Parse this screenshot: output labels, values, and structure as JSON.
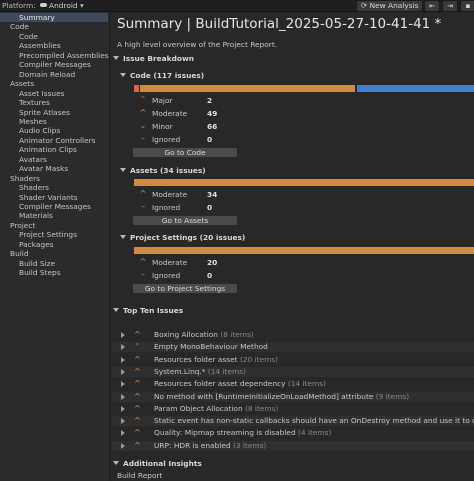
{
  "toolbar": {
    "platform_label": "Platform:",
    "platform_value": "Android",
    "new_analysis_label": "New Analysis",
    "import_icon": "import-icon",
    "export_icon": "export-icon"
  },
  "sidebar": {
    "items": [
      {
        "label": "Summary",
        "indent": 1,
        "selected": true
      },
      {
        "label": "Code",
        "indent": 0
      },
      {
        "label": "Code",
        "indent": 1
      },
      {
        "label": "Assemblies",
        "indent": 1
      },
      {
        "label": "Precompiled Assemblies",
        "indent": 1
      },
      {
        "label": "Compiler Messages",
        "indent": 1
      },
      {
        "label": "Domain Reload",
        "indent": 1
      },
      {
        "label": "Assets",
        "indent": 0
      },
      {
        "label": "Asset Issues",
        "indent": 1
      },
      {
        "label": "Textures",
        "indent": 1
      },
      {
        "label": "Sprite Atlases",
        "indent": 1
      },
      {
        "label": "Meshes",
        "indent": 1
      },
      {
        "label": "Audio Clips",
        "indent": 1
      },
      {
        "label": "Animator Controllers",
        "indent": 1
      },
      {
        "label": "Animation Clips",
        "indent": 1
      },
      {
        "label": "Avatars",
        "indent": 1
      },
      {
        "label": "Avatar Masks",
        "indent": 1
      },
      {
        "label": "Shaders",
        "indent": 0
      },
      {
        "label": "Shaders",
        "indent": 1
      },
      {
        "label": "Shader Variants",
        "indent": 1
      },
      {
        "label": "Compiler Messages",
        "indent": 1
      },
      {
        "label": "Materials",
        "indent": 1
      },
      {
        "label": "Project",
        "indent": 0
      },
      {
        "label": "Project Settings",
        "indent": 1
      },
      {
        "label": "Packages",
        "indent": 1
      },
      {
        "label": "Build",
        "indent": 0
      },
      {
        "label": "Build Size",
        "indent": 1
      },
      {
        "label": "Build Steps",
        "indent": 1
      }
    ]
  },
  "main": {
    "title": "Summary  |  BuildTutorial_2025-05-27-10-41-41 *",
    "subtitle": "A high level overview of the Project Report.",
    "issue_breakdown_label": "Issue Breakdown",
    "code": {
      "header": "Code (117 issues)",
      "rows": [
        {
          "label": "Major",
          "value": "2",
          "icon": "major-severity-icon"
        },
        {
          "label": "Moderate",
          "value": "49",
          "icon": "moderate-severity-icon"
        },
        {
          "label": "Minor",
          "value": "66",
          "icon": "minor-severity-icon"
        },
        {
          "label": "Ignored",
          "value": "0",
          "icon": "ignored-icon"
        }
      ],
      "button": "Go to Code"
    },
    "assets": {
      "header": "Assets (34 issues)",
      "rows": [
        {
          "label": "Moderate",
          "value": "34",
          "icon": "moderate-severity-icon"
        },
        {
          "label": "Ignored",
          "value": "0",
          "icon": "ignored-icon"
        }
      ],
      "button": "Go to Assets"
    },
    "settings": {
      "header": "Project Settings (20 issues)",
      "rows": [
        {
          "label": "Moderate",
          "value": "20",
          "icon": "moderate-severity-icon"
        },
        {
          "label": "Ignored",
          "value": "0",
          "icon": "ignored-icon"
        }
      ],
      "button": "Go to Project Settings"
    },
    "top_ten": {
      "header": "Top Ten Issues",
      "items": [
        {
          "title": "Boxing Allocation",
          "count": "(8 items)",
          "severity": "moderate"
        },
        {
          "title": "Empty MonoBehaviour Method",
          "count": "",
          "severity": "major"
        },
        {
          "title": "Resources folder asset",
          "count": "(20 items)",
          "severity": "moderate"
        },
        {
          "title": "System.Linq.*",
          "count": "(14 items)",
          "severity": "moderate"
        },
        {
          "title": "Resources folder asset dependency",
          "count": "(14 items)",
          "severity": "moderate"
        },
        {
          "title": "No method with [RuntimeInitializeOnLoadMethod] attribute",
          "count": "(9 items)",
          "severity": "moderate"
        },
        {
          "title": "Param Object Allocation",
          "count": "(8 items)",
          "severity": "moderate"
        },
        {
          "title": "Static event has non-static callbacks should have an OnDestroy method and use it to deregiste",
          "count": "",
          "severity": "moderate"
        },
        {
          "title": "Quality: Mipmap streaming is disabled",
          "count": "(4 items)",
          "severity": "moderate"
        },
        {
          "title": "URP: HDR is enabled",
          "count": "(3 items)",
          "severity": "moderate"
        }
      ]
    },
    "additional": {
      "header": "Additional Insights",
      "first_item": "Build Report"
    }
  },
  "colors": {
    "major": "#e0662e",
    "moderate": "#e8904a",
    "minor": "#3f7fd0",
    "bar_orange": "#d48a3a",
    "selection": "#3f4a5a"
  }
}
